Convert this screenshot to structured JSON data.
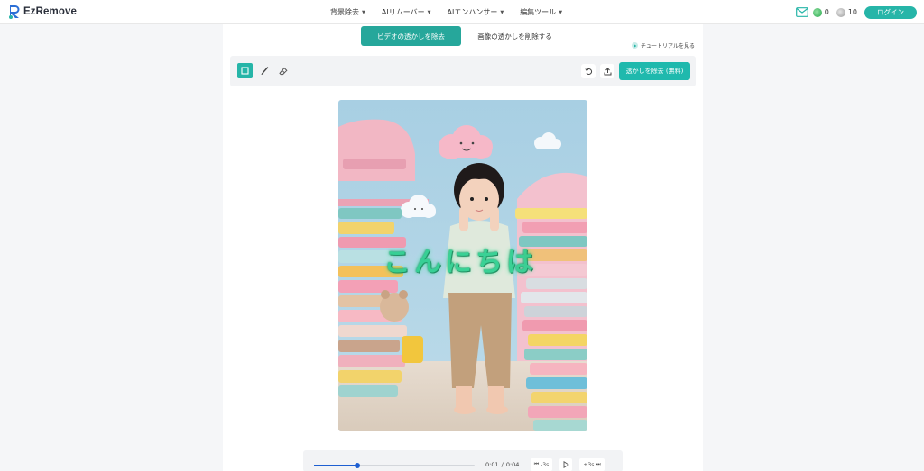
{
  "brand": {
    "name": "EzRemove"
  },
  "nav": {
    "items": [
      {
        "label": "背景除去"
      },
      {
        "label": "AIリムーバー"
      },
      {
        "label": "AIエンハンサー"
      },
      {
        "label": "編集ツール"
      }
    ]
  },
  "header_right": {
    "credit_green": "0",
    "credit_gray": "10",
    "login_label": "ログイン"
  },
  "tabs": {
    "video": "ビデオの透かしを除去",
    "image": "画像の透かしを削除する"
  },
  "tutorial_label": "チュートリアルを見る",
  "toolbar": {
    "remove_label": "透かしを除去 (無料)"
  },
  "watermark_text": "こんにちは",
  "player": {
    "current": "0:01",
    "separator": "/",
    "total": "0:04",
    "back_label": "-3s",
    "forward_label": "+3s",
    "progress": 0.27
  },
  "colors": {
    "accent": "#26b5a8",
    "progress": "#1e5fd1",
    "watermark": "#2dcf8f"
  }
}
